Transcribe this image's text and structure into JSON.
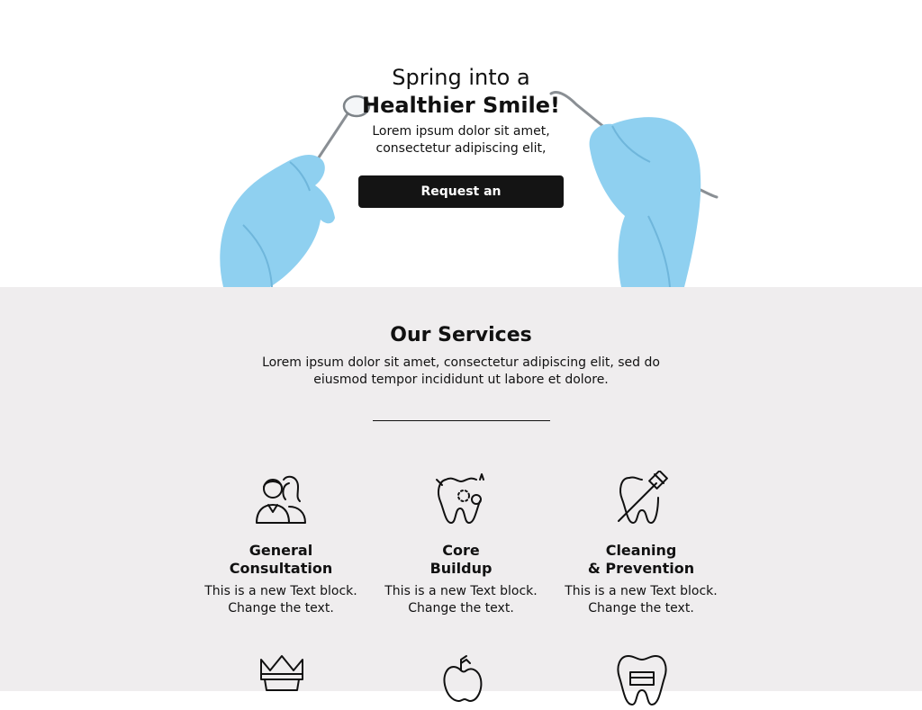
{
  "hero": {
    "line1": "Spring into a",
    "line2": "Healthier Smile!",
    "sub_line1": "Lorem ipsum dolor sit amet,",
    "sub_line2": "consectetur adipiscing elit,",
    "cta_label": "Request an Appointment",
    "glove_color": "#8fd0f0"
  },
  "services": {
    "title": "Our Services",
    "sub_line1": "Lorem ipsum dolor sit amet, consectetur adipiscing elit, sed do",
    "sub_line2": "eiusmod tempor incididunt ut labore et dolore.",
    "cards": [
      {
        "icon": "consultation-people-icon",
        "title_line1": "General",
        "title_line2": "Consultation",
        "text_line1": "This is a new Text block.",
        "text_line2": "Change the text."
      },
      {
        "icon": "tooth-buildup-icon",
        "title_line1": "Core",
        "title_line2": "Buildup",
        "text_line1": "This is a new Text block.",
        "text_line2": "Change the text."
      },
      {
        "icon": "tooth-brush-icon",
        "title_line1": "Cleaning",
        "title_line2": "& Prevention",
        "text_line1": "This is a new Text block.",
        "text_line2": "Change the text."
      }
    ],
    "row2_icons": [
      "tooth-crown-icon",
      "apple-icon",
      "tooth-filling-icon"
    ]
  },
  "colors": {
    "services_bg": "#efedee",
    "button_bg": "#141414",
    "text": "#111111"
  }
}
